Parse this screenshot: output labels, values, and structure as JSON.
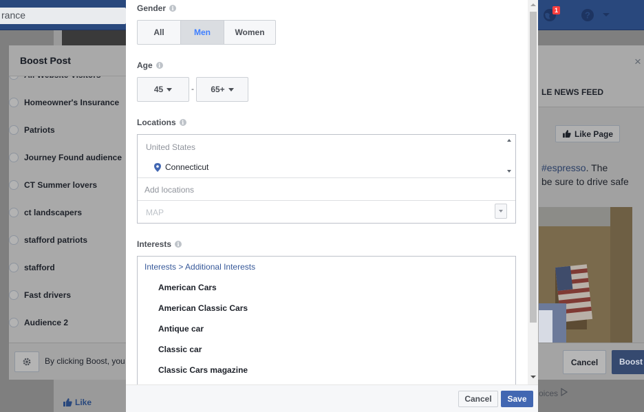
{
  "background": {
    "search_text": "rance",
    "notification_count": "1",
    "like_label": "Like",
    "choices_text": "oices"
  },
  "boost_dialog": {
    "title": "Boost Post",
    "close_glyph": "×",
    "audiences": [
      {
        "label": "All Website Visitors"
      },
      {
        "label": "Homeowner's Insurance"
      },
      {
        "label": "Patriots"
      },
      {
        "label": "Journey Found audience"
      },
      {
        "label": "CT Summer lovers"
      },
      {
        "label": "ct landscapers"
      },
      {
        "label": "stafford patriots"
      },
      {
        "label": "stafford"
      },
      {
        "label": "Fast drivers"
      },
      {
        "label": "Audience 2"
      }
    ],
    "terms_text": "By clicking Boost, you",
    "cancel_label": "Cancel",
    "boost_label": "Boost",
    "preview_tab": "LE NEWS FEED",
    "like_page_label": "Like Page",
    "preview_hashtag": "#espresso",
    "preview_text_after_tag": ". The",
    "preview_text_line2": "be sure to drive safe"
  },
  "audience_editor": {
    "gender": {
      "label": "Gender",
      "options": [
        "All",
        "Men",
        "Women"
      ],
      "selected": "Men"
    },
    "age": {
      "label": "Age",
      "min": "45",
      "max": "65+",
      "separator": "-"
    },
    "locations": {
      "label": "Locations",
      "country": "United States",
      "items": [
        "Connecticut"
      ],
      "input_placeholder": "Add locations",
      "map_label": "MAP"
    },
    "interests": {
      "label": "Interests",
      "breadcrumb": "Interests > Additional Interests",
      "items": [
        "American Cars",
        "American Classic Cars",
        "Antique car",
        "Classic car",
        "Classic Cars magazine"
      ]
    },
    "footer": {
      "cancel_label": "Cancel",
      "save_label": "Save"
    }
  },
  "colors": {
    "brand_blue": "#4267b2",
    "selected_text": "#4080ff",
    "link": "#365899"
  }
}
